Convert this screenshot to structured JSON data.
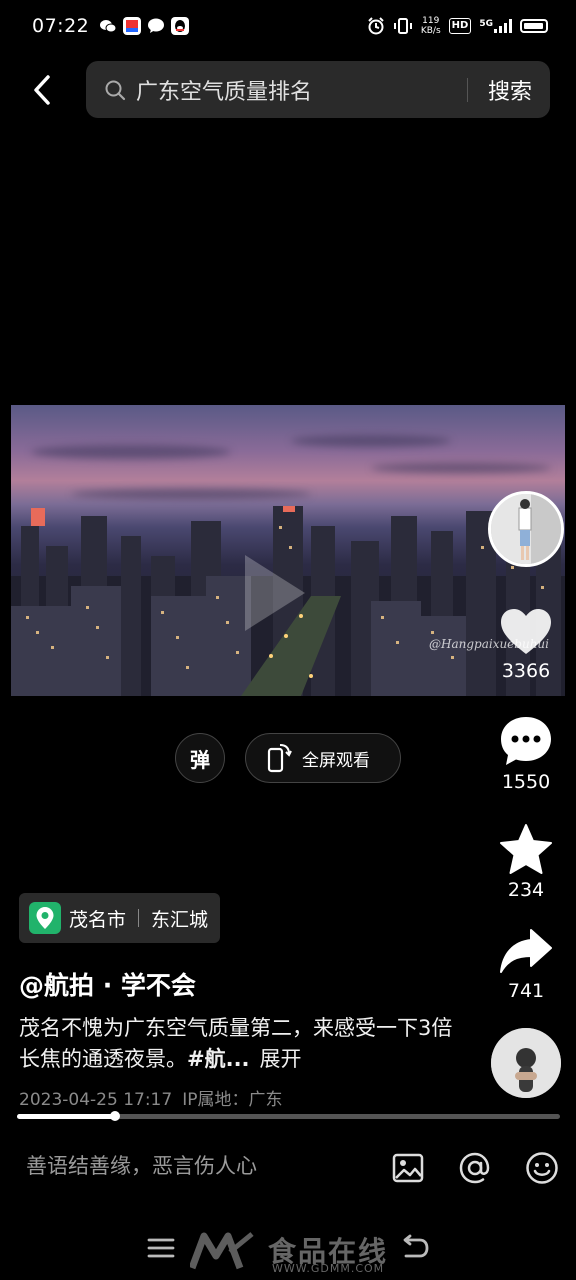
{
  "status_bar": {
    "time": "07:22",
    "network_speed_value": "119",
    "network_speed_unit": "KB/s",
    "hd_label": "HD",
    "network_type": "5G"
  },
  "header": {
    "search_query": "广东空气质量排名",
    "search_button": "搜索"
  },
  "video": {
    "watermark": "@Hangpaixuebuhui"
  },
  "actions": {
    "like_count": "3366",
    "comment_count": "1550",
    "favorite_count": "234",
    "share_count": "741"
  },
  "controls": {
    "danmu_label": "弹",
    "fullscreen_label": "全屏观看"
  },
  "location": {
    "city": "茂名市",
    "district": "东汇城"
  },
  "post": {
    "author": "@航拍 · 学不会",
    "description": "茂名不愧为广东空气质量第二，来感受一下3倍长焦的通透夜景。",
    "hashtag": "#航...",
    "expand_label": "展开",
    "datetime": "2023-04-25 17:17",
    "ip_location": "IP属地：广东"
  },
  "playback": {
    "progress_fraction": 0.18
  },
  "comment_bar": {
    "placeholder": "善语结善缘，恶言伤人心"
  },
  "nav_watermark": {
    "brand": "食品在线",
    "url": "WWW.GDMM.COM"
  },
  "colors": {
    "background": "#000000",
    "search_bg": "#2a2a2a",
    "location_pin": "#21b36b"
  }
}
